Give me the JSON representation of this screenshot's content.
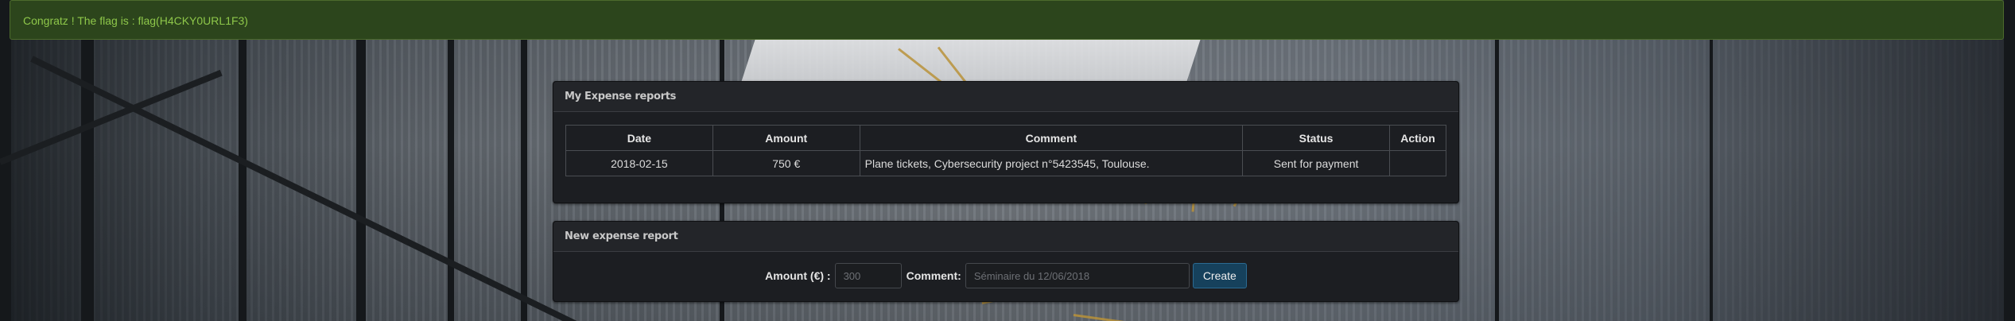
{
  "alert": {
    "message": "Congratz ! The flag is : flag(H4CKY0URL1F3)"
  },
  "reports_panel": {
    "title": "My Expense reports",
    "columns": [
      "Date",
      "Amount",
      "Comment",
      "Status",
      "Action"
    ],
    "rows": [
      {
        "date": "2018-02-15",
        "amount": "750 €",
        "comment": "Plane tickets, Cybersecurity project n°5423545, Toulouse.",
        "status": "Sent for payment",
        "action": ""
      }
    ]
  },
  "new_report_panel": {
    "title": "New expense report",
    "amount_label": "Amount (€) :",
    "amount_placeholder": "300",
    "comment_label": "Comment:",
    "comment_placeholder": "Séminaire du 12/06/2018",
    "create_label": "Create"
  },
  "colors": {
    "alert_bg": "#2c451c",
    "alert_text": "#8ec74a",
    "panel_bg": "#1c1e22",
    "button_bg": "#16415c"
  }
}
